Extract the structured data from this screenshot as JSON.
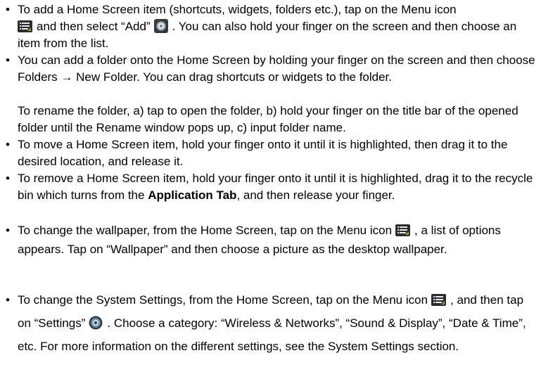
{
  "bullet_char": "•",
  "icons": {
    "menu": "menu-icon",
    "add": "add-icon",
    "settings": "settings-icon"
  },
  "items": [
    {
      "p1": "To add a Home Screen item (shortcuts, widgets, folders etc.), tap on the Menu icon",
      "p2": "and then select “Add”",
      "p3": ". You can also hold your finger on the screen and then choose an item from the list."
    },
    {
      "text": "You can add a folder onto the Home Screen by holding your finger on the screen and then choose Folders → New Folder. You can drag shortcuts or widgets to the folder.",
      "sub": "To rename the folder, a) tap to open the folder, b) hold your finger on the title bar of the opened folder until the Rename window pops up, c) input folder name."
    },
    {
      "text": "To move a Home Screen item, hold your finger onto it until it is highlighted, then drag it to the desired location, and release it."
    },
    {
      "p1": "To remove a Home Screen item, hold your finger onto it until it is highlighted, drag it to the recycle bin which turns from the ",
      "bold": "Application Tab",
      "p2": ", and then release your finger."
    },
    {
      "p1": "To change the wallpaper, from the Home Screen, tap on the Menu icon",
      "p2": ", a list of options appears. Tap on “Wallpaper” and then choose a picture as the desktop wallpaper."
    },
    {
      "p1": "To change the System Settings, from the Home Screen, tap on the Menu icon",
      "p2": ", and then tap on “Settings”",
      "p3": ". Choose a category: “Wireless & Networks”, “Sound & Display”, “Date & Time”, etc. For more information on the different settings, see the System Settings section."
    }
  ],
  "colors": {
    "text": "#000000",
    "menu_icon_bg": "#2b2b2b",
    "menu_icon_lines": "#e8e8e8",
    "menu_icon_accent": "#6fb33a"
  }
}
